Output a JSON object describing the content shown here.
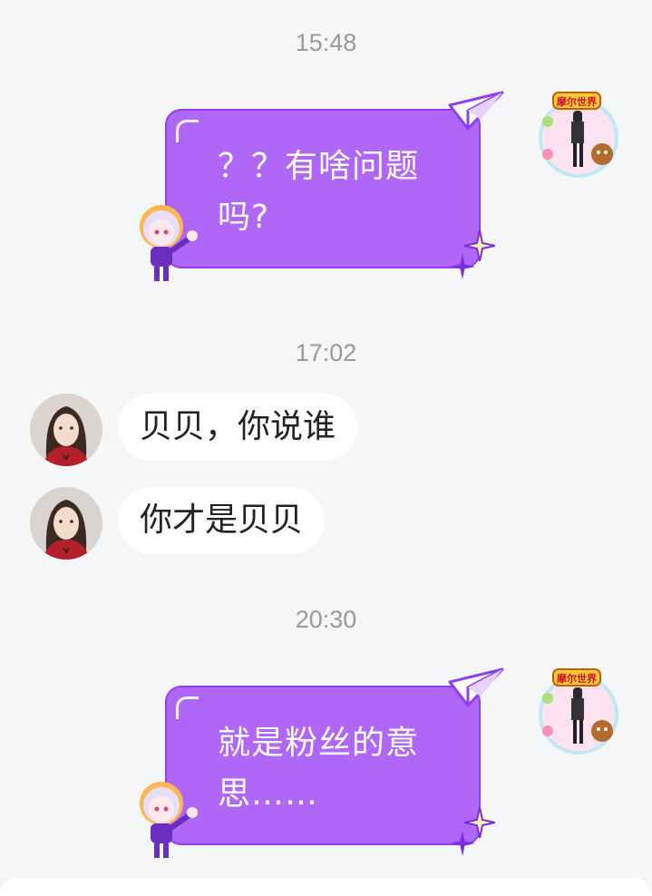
{
  "messages": [
    {
      "type": "timestamp",
      "text": "15:48"
    },
    {
      "type": "outgoing",
      "text": "？？有啥问题吗?"
    },
    {
      "type": "timestamp",
      "text": "17:02"
    },
    {
      "type": "incoming",
      "text": "贝贝，你说谁"
    },
    {
      "type": "incoming",
      "text": "你才是贝贝"
    },
    {
      "type": "timestamp",
      "text": "20:30"
    },
    {
      "type": "outgoing",
      "text": "就是粉丝的意思……"
    }
  ],
  "avatar_badge_text": "摩尔世界",
  "colors": {
    "bubble_purple": "#b067f8",
    "bubble_border": "#8e3ff0",
    "incoming_bg": "#ffffff",
    "background": "#f5f6f8"
  }
}
